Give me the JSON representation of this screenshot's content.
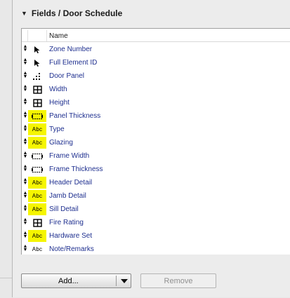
{
  "panel": {
    "title": "Fields /  Door Schedule"
  },
  "table": {
    "column_header": "Name",
    "rows": [
      {
        "label": "Zone Number",
        "icon": "cursor-icon",
        "highlight": false
      },
      {
        "label": "Full Element ID",
        "icon": "cursor-icon",
        "highlight": false
      },
      {
        "label": "Door Panel",
        "icon": "dots-icon",
        "highlight": false
      },
      {
        "label": "Width",
        "icon": "grid-icon",
        "highlight": false
      },
      {
        "label": "Height",
        "icon": "grid-icon",
        "highlight": false
      },
      {
        "label": "Panel Thickness",
        "icon": "dotted-rect-icon",
        "highlight": true
      },
      {
        "label": "Type",
        "icon": "abc-icon",
        "highlight": true
      },
      {
        "label": "Glazing",
        "icon": "abc-icon",
        "highlight": true
      },
      {
        "label": "Frame Width",
        "icon": "dotted-rect-icon",
        "highlight": false
      },
      {
        "label": "Frame Thickness",
        "icon": "dotted-rect-icon",
        "highlight": false
      },
      {
        "label": "Header Detail",
        "icon": "abc-icon",
        "highlight": true
      },
      {
        "label": "Jamb Detail",
        "icon": "abc-icon",
        "highlight": true
      },
      {
        "label": "Sill Detail",
        "icon": "abc-icon",
        "highlight": true
      },
      {
        "label": "Fire Rating",
        "icon": "grid-icon",
        "highlight": false
      },
      {
        "label": "Hardware Set",
        "icon": "abc-icon",
        "highlight": true
      },
      {
        "label": "Note/Remarks",
        "icon": "abc-icon",
        "highlight": false
      }
    ],
    "abc_text": "Abc"
  },
  "buttons": {
    "add_label": "Add...",
    "remove_label": "Remove"
  },
  "colors": {
    "highlight": "#f5f500",
    "link_text": "#1e2f8f"
  }
}
